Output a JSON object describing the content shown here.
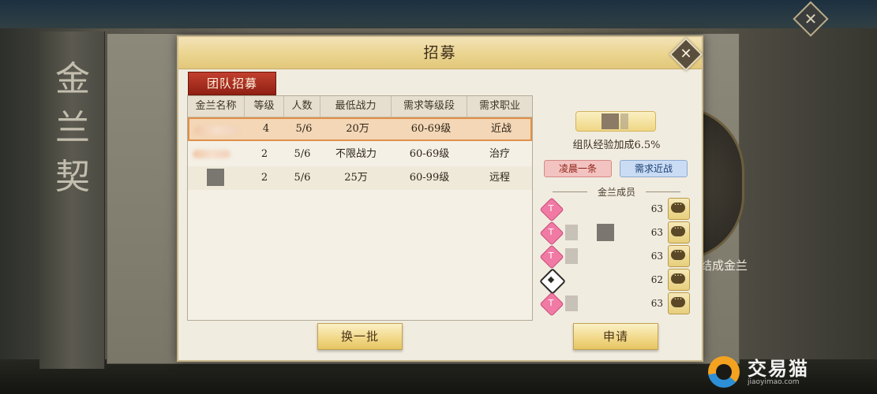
{
  "side": {
    "title": "金兰契"
  },
  "right_hint": "处结成金兰",
  "dialog": {
    "title": "招募",
    "close_icon": "close-icon",
    "tab_active": "团队招募"
  },
  "table": {
    "headers": [
      "金兰名称",
      "等级",
      "人数",
      "最低战力",
      "需求等级段",
      "需求职业"
    ],
    "rows": [
      {
        "level": "4",
        "members": "5/6",
        "min_power": "20万",
        "level_range": "60-69级",
        "class": "近战"
      },
      {
        "level": "2",
        "members": "5/6",
        "min_power": "不限战力",
        "level_range": "60-69级",
        "class": "治疗"
      },
      {
        "level": "2",
        "members": "5/6",
        "min_power": "25万",
        "level_range": "60-99级",
        "class": "远程"
      }
    ]
  },
  "buttons": {
    "refresh": "换一批",
    "apply": "申请"
  },
  "info": {
    "exp_bonus": "组队经验加成6.5%",
    "tag_red": "凌晨一条",
    "tag_blue": "需求近战",
    "members_title": "金兰成员",
    "members": [
      {
        "icon": "pink-diamond-icon",
        "level": "63"
      },
      {
        "icon": "pink-diamond-icon",
        "level": "63"
      },
      {
        "icon": "pink-diamond-icon",
        "level": "63"
      },
      {
        "icon": "dark-diamond-icon",
        "level": "62"
      },
      {
        "icon": "pink-diamond-icon",
        "level": "63"
      }
    ]
  },
  "watermark": {
    "text": "交易猫",
    "sub": "jiaoyimao.com"
  }
}
